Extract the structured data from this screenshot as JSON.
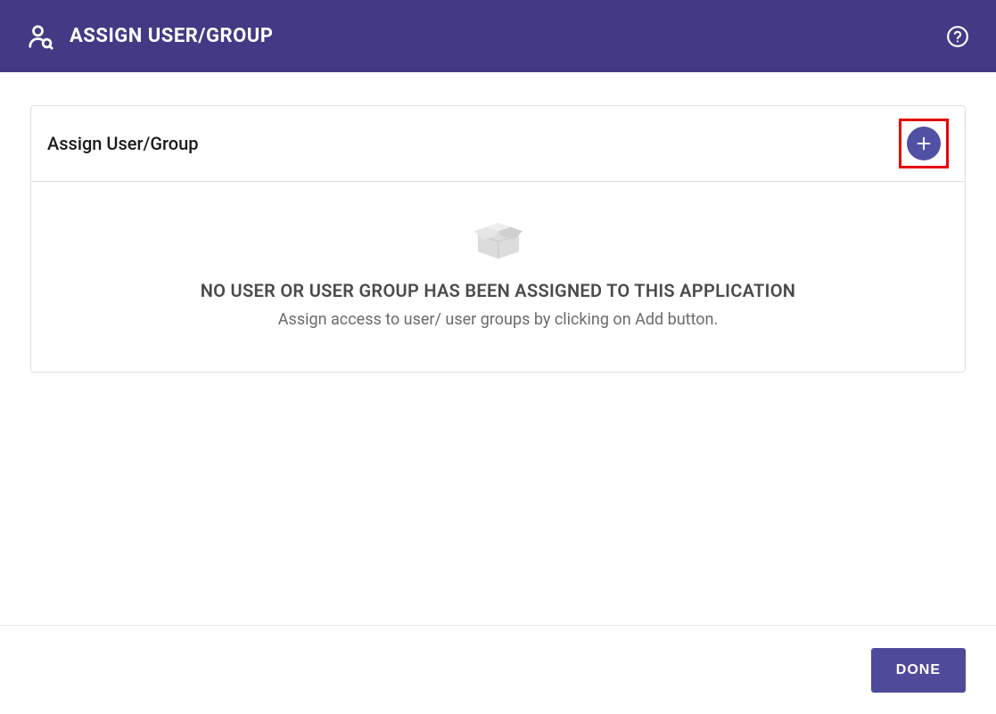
{
  "header": {
    "title": "ASSIGN USER/GROUP"
  },
  "card": {
    "title": "Assign User/Group"
  },
  "empty_state": {
    "title": "NO USER OR USER GROUP HAS BEEN ASSIGNED TO THIS APPLICATION",
    "subtitle": "Assign access to user/ user groups by clicking on Add button."
  },
  "footer": {
    "done_label": "DONE"
  }
}
